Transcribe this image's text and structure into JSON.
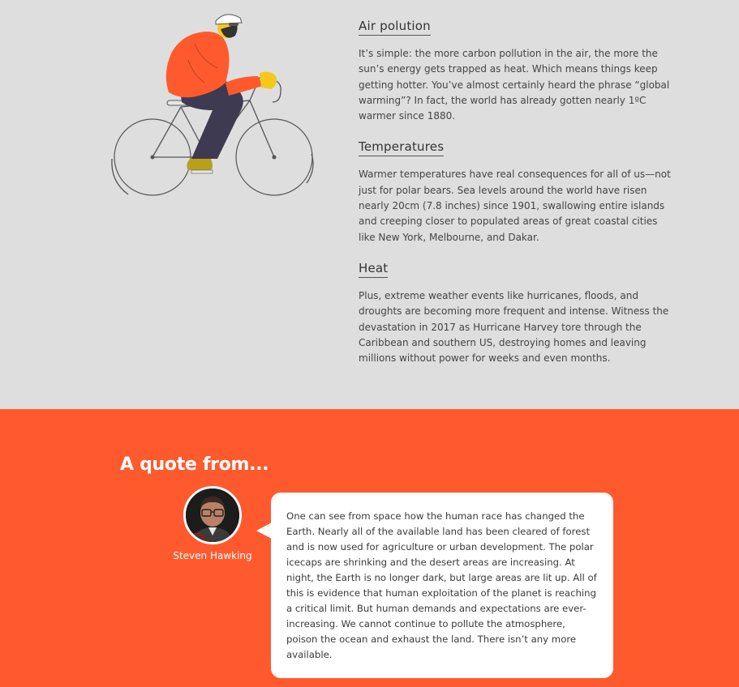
{
  "topics": [
    {
      "title": "Air polution",
      "body": "It’s simple: the more carbon pollution in the air, the more the sun’s energy gets trapped as heat. Which means things keep getting hotter. You’ve almost certainly heard the phrase “global warming”? In fact, the world has already gotten nearly 1ºC warmer since 1880."
    },
    {
      "title": "Temperatures",
      "body": "Warmer temperatures have real consequences for all of us—not just for polar bears. Sea levels around the world have risen nearly 20cm (7.8 inches) since 1901, swallowing entire islands and creeping closer to populated areas of great coastal cities like New York, Melbourne, and Dakar."
    },
    {
      "title": "Heat",
      "body": "Plus, extreme weather events like hurricanes, floods, and droughts are becoming more frequent and intense. Witness the devastation in 2017 as Hurricane Harvey tore through the Caribbean and southern US, destroying homes and leaving millions without power for weeks and even months."
    }
  ],
  "quote": {
    "heading": "A quote from...",
    "author": "Steven Hawking",
    "text": "One can see from space how the human race has changed the Earth. Nearly all of the available land has been cleared of forest and is now used for agriculture or urban development. The polar icecaps are shrinking and the desert areas are increasing. At night, the Earth is no longer dark, but large areas are lit up. All of this is evidence that human exploitation of the planet is reaching a critical limit. But human demands and expectations are ever-increasing. We cannot continue to pollute the atmosphere, poison the ocean and exhaust the land. There isn’t any more available."
  },
  "illustration": {
    "icon": "cyclist-illustration",
    "jacket_color": "#fe5a2e",
    "pants_color": "#3e3a52",
    "accent_color": "#f4c91c"
  },
  "colors": {
    "top_background": "#dedede",
    "quote_background": "#fe5a2e",
    "bubble_background": "#ffffff"
  }
}
